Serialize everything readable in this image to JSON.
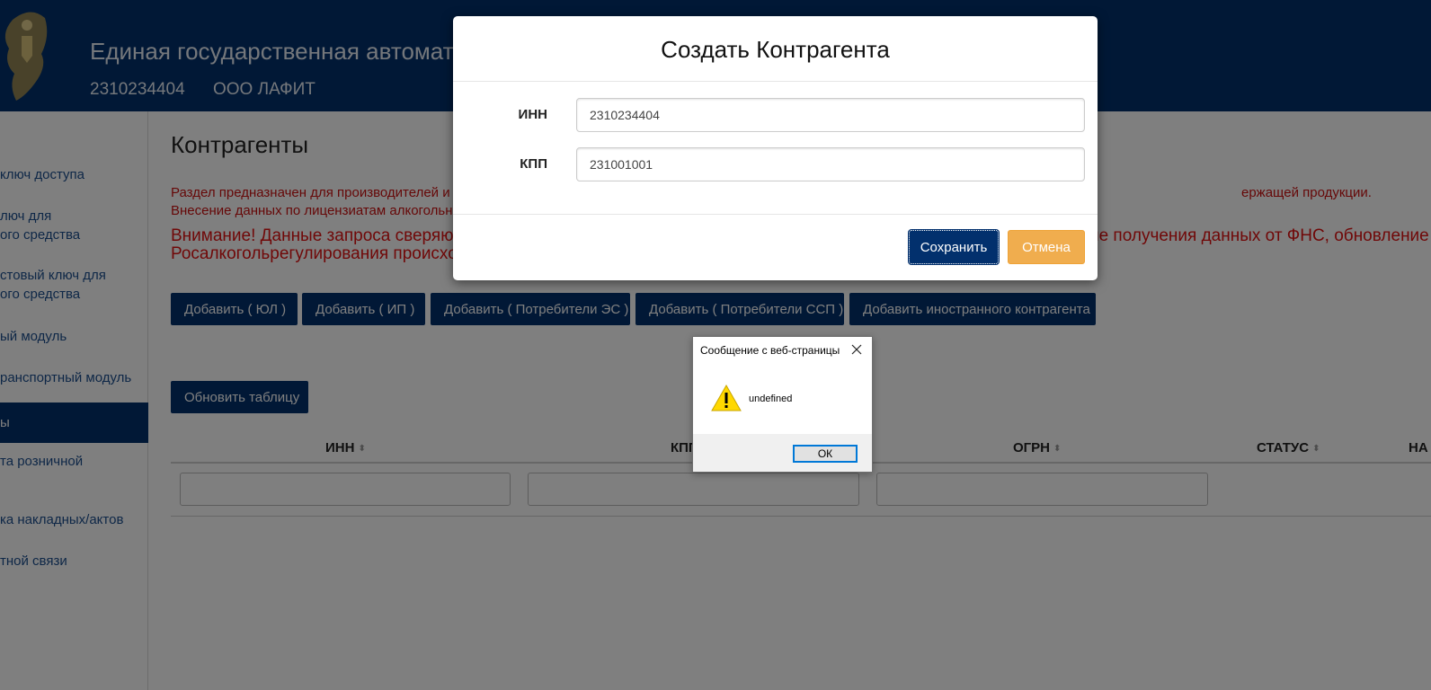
{
  "header": {
    "title": "Единая государственная автоматизированная информационная система",
    "inn": "2310234404",
    "org_name": "ООО ЛАФИТ"
  },
  "sidebar": {
    "items": [
      {
        "label": "ключ доступа"
      },
      {
        "label": "люч для"
      },
      {
        "label": "ого средства"
      },
      {
        "label": "стовый ключ для"
      },
      {
        "label": "ого средства"
      },
      {
        "label": "ый модуль"
      },
      {
        "label": "ранспортный модуль"
      },
      {
        "label": "ы"
      },
      {
        "label": "та розничной"
      },
      {
        "label": "ка накладных/актов"
      },
      {
        "label": "тной связи"
      }
    ]
  },
  "main": {
    "title": "Контрагенты",
    "info_line1": "Раздел предназначен для производителей и ор",
    "info_line1_tail": "ержащей продукции.",
    "info_line2": "Внесение данных по лицензиатам алкогольно",
    "warning_line1": "Внимание! Данные запроса сверяются",
    "warning_line1_tail": "сле получения данных от ФНС, обновление с",
    "warning_line2": "Росалкогольрегулирования происходи",
    "buttons": {
      "add_ul": "Добавить ( ЮЛ )",
      "add_ip": "Добавить ( ИП )",
      "add_es": "Добавить ( Потребители ЭС )",
      "add_ssp": "Добавить ( Потребители ССП )",
      "add_foreign": "Добавить иностранного контрагента",
      "refresh": "Обновить таблицу"
    },
    "table": {
      "columns": [
        "ИНН",
        "КПП",
        "ОГРН",
        "СТАТУС",
        "НА"
      ]
    }
  },
  "modal": {
    "title": "Создать Контрагента",
    "inn_label": "ИНН",
    "inn_value": "2310234404",
    "kpp_label": "КПП",
    "kpp_value": "231001001",
    "save_label": "Сохранить",
    "cancel_label": "Отмена"
  },
  "alert": {
    "title": "Сообщение с веб-страницы",
    "message": "undefined",
    "ok_label": "ОК"
  },
  "colors": {
    "brand": "#02306d",
    "warning_red": "#e01010",
    "cancel_orange": "#f0ad4e"
  }
}
